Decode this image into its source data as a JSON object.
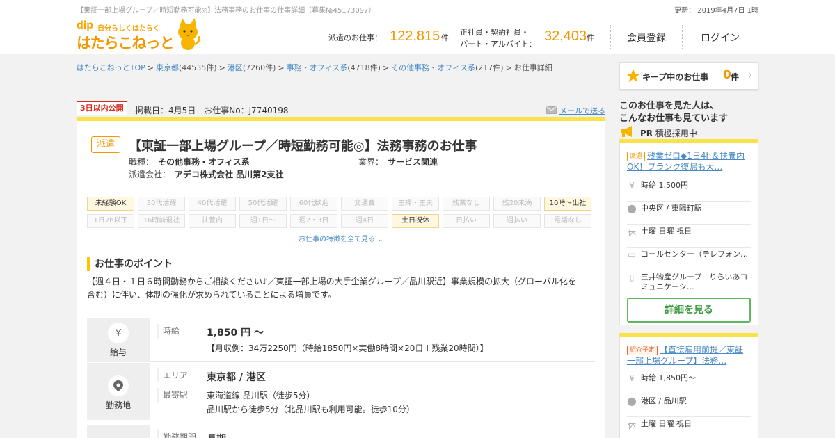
{
  "header": {
    "top_meta": "【東証一部上場グループ／時短勤務可能◎】法務事務のお仕事の仕事詳細（募集№45173097）",
    "update": "更新： 2019年4月7日 1時",
    "logo_dip": "dip",
    "logo_sub": "自分らしくはたらく",
    "logo_main": "はたらこねっと",
    "stat1_label": "派遣のお仕事：",
    "stat1_value": "122,815",
    "stat1_unit": "件",
    "stat2_label_1": "正社員・契約社員・",
    "stat2_label_2": "パート・アルバイト：",
    "stat2_value": "32,403",
    "stat2_unit": "件",
    "register": "会員登録",
    "login": "ログイン"
  },
  "breadcrumb": [
    {
      "text": "はたらこねっとTOP",
      "count": ""
    },
    {
      "text": "東京都",
      "count": "(44535件)"
    },
    {
      "text": "港区",
      "count": "(7260件)"
    },
    {
      "text": "事務・オフィス系",
      "count": "(4718件)"
    },
    {
      "text": "その他事務・オフィス系",
      "count": "(217件)"
    }
  ],
  "breadcrumb_current": "お仕事詳細",
  "keep": {
    "label": "キープ中のお仕事",
    "count": "0",
    "unit": "件"
  },
  "job": {
    "new_badge": "3日以内公開",
    "posted": "掲載日：4月5日　お仕事No：J7740198",
    "mail": "メールで送る",
    "type_badge": "派遣",
    "title": "【東証一部上場グループ／時短勤務可能◎】法務事務のお仕事",
    "occupation_label": "職種：",
    "occupation": "その他事務・オフィス系",
    "industry_label": "業界：",
    "industry": "サービス関連",
    "company_label": "派遣会社：",
    "company": "アデコ株式会社 品川第2支社",
    "tags_row1": [
      "未経験OK",
      "30代活躍",
      "40代活躍",
      "50代活躍",
      "60代歓迎",
      "交通費",
      "主婦・主夫",
      "残業なし",
      "残20未満",
      "10時～出社"
    ],
    "tags_row2": [
      "1日7h以下",
      "16時前退社",
      "扶養内",
      "週1日～",
      "週2・3日",
      "週4日",
      "土日祝休",
      "日払い",
      "週払い",
      "電話なし"
    ],
    "tags_more": "お仕事の特徴を全て見る",
    "point_title": "お仕事のポイント",
    "point_text": "【週４日・１日６時間勤務からご相談ください♪／東証一部上場の大手企業グループ／品川駅近】事業規模の拡大（グローバル化を含む）に伴い、体制の強化が求められていることによる増員です。",
    "salary_label": "給与",
    "salary_key": "時給",
    "salary_main": "1,850 円 ～",
    "salary_sub": "【月収例：34万2250円（時給1850円×実働8時間×20日＋残業20時間）】",
    "location_label": "勤務地",
    "area_key": "エリア",
    "area_val": "東京都 / 港区",
    "station_key": "最寄駅",
    "station_val1": "東海道線 品川駅（徒歩5分）",
    "station_val2": "品川駅から徒歩5分（北品川駅も利用可能。徒歩10分）",
    "period_key": "勤務期間",
    "period_val": "長期"
  },
  "side": {
    "title_1": "このお仕事を見た人は、",
    "title_2": "こんなお仕事も見ています",
    "pr": "PR",
    "pr_text": "積極採用中",
    "cards": [
      {
        "badge": "派遣",
        "title": "残業ゼロ◆1日4h＆扶養内OK！ブランク復帰も大…",
        "salary": "時給 1,500円",
        "place": "中央区 / 東陽町駅",
        "holiday": "土曜 日曜 祝日",
        "job": "コールセンター（テレフォン…",
        "company": "三井物産グループ　りらいあコミュニケーシ…",
        "button": "詳細を見る"
      },
      {
        "badge": "紹介予定",
        "title": "【直接雇用前提／東証一部上場グループ】法務…",
        "salary": "時給 1,850円～",
        "place": "港区 / 品川駅",
        "holiday": "土曜 日曜 祝日"
      }
    ]
  },
  "colors": {
    "accent": "#f39800",
    "yellow": "#fce24a",
    "link": "#4a8ac4",
    "green": "#5fb760",
    "red": "#d8271c"
  }
}
